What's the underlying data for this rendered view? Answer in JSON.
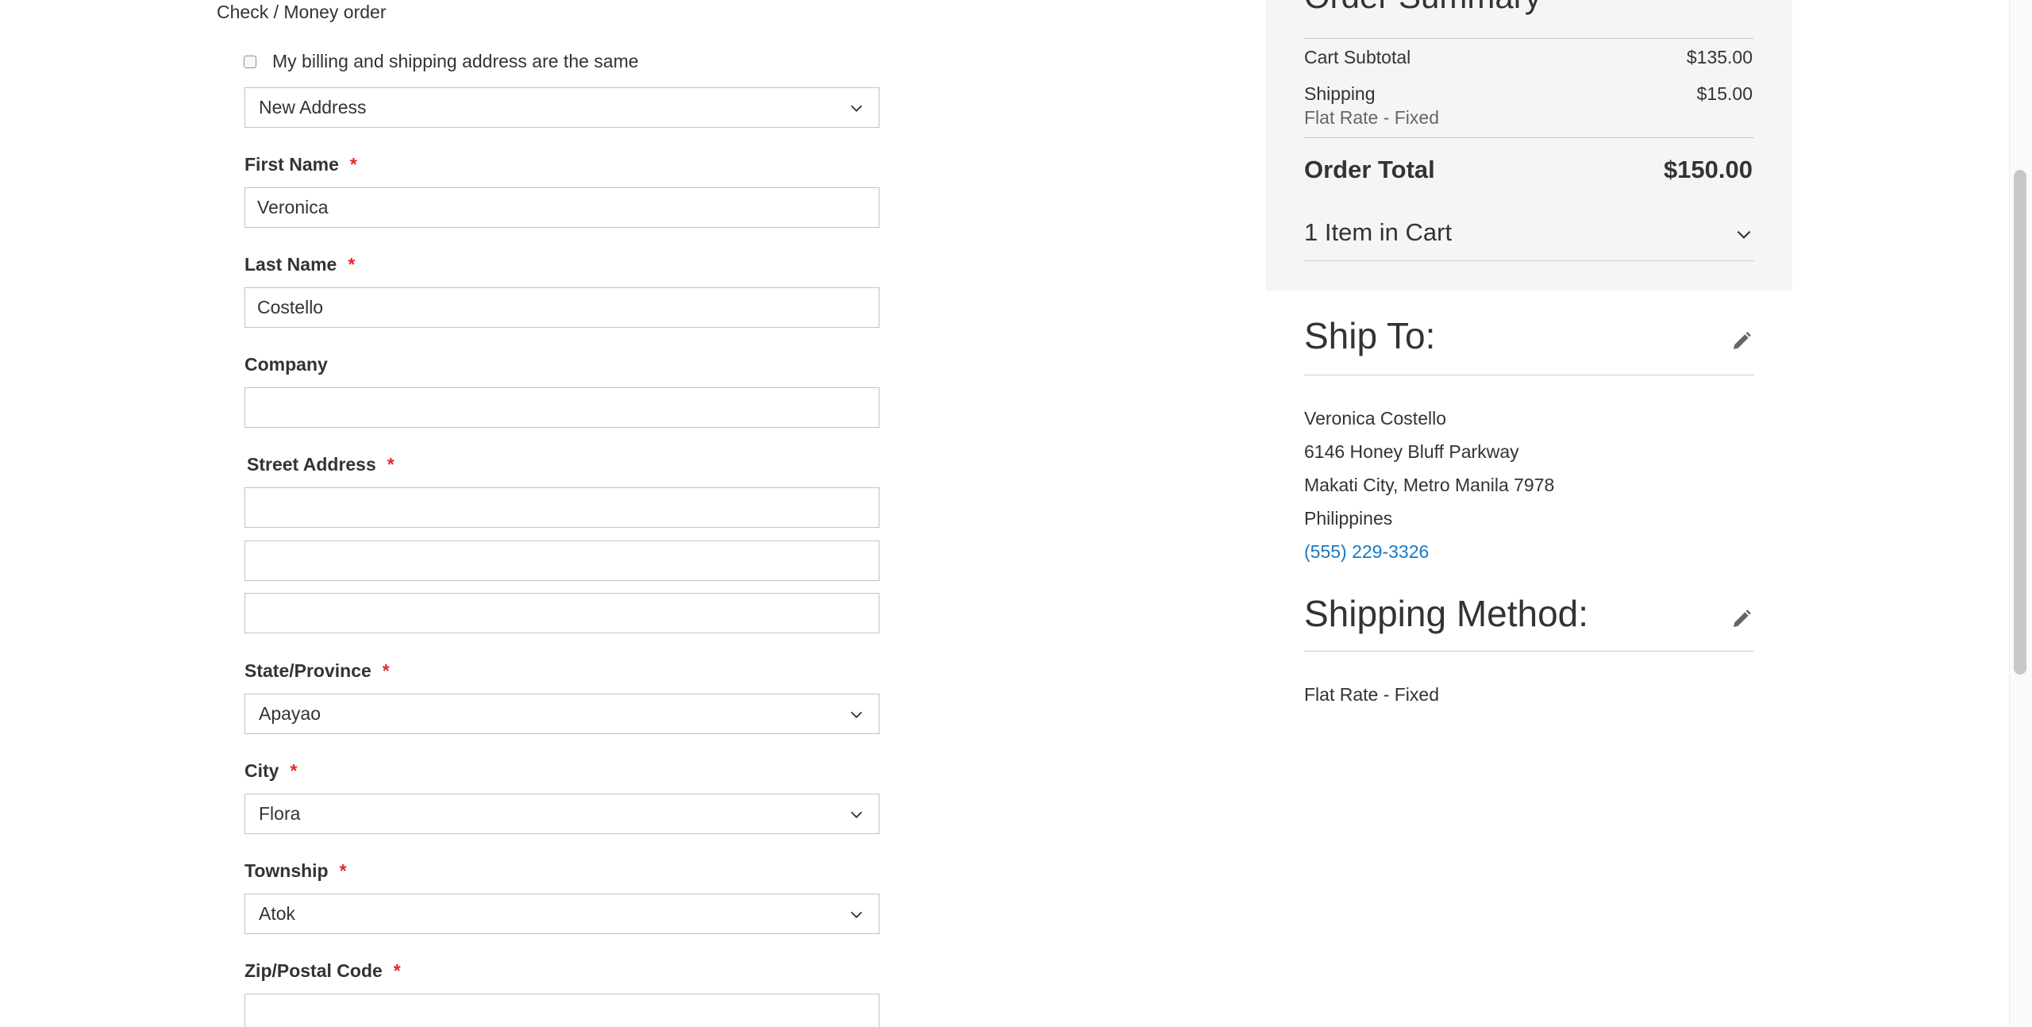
{
  "payment": {
    "method_label": "Check / Money order",
    "same_address_label": "My billing and shipping address are the same",
    "same_address_checked": false
  },
  "billing_form": {
    "address_select": {
      "value": "New Address"
    },
    "first_name": {
      "label": "First Name",
      "value": "Veronica",
      "required": true
    },
    "last_name": {
      "label": "Last Name",
      "value": "Costello",
      "required": true
    },
    "company": {
      "label": "Company",
      "value": ""
    },
    "street": {
      "label": "Street Address",
      "required": true,
      "lines": [
        "",
        "",
        ""
      ]
    },
    "state": {
      "label": "State/Province",
      "value": "Apayao",
      "required": true
    },
    "city": {
      "label": "City",
      "value": "Flora",
      "required": true
    },
    "township": {
      "label": "Township",
      "value": "Atok",
      "required": true
    },
    "zip": {
      "label": "Zip/Postal Code",
      "value": "",
      "required": true
    },
    "required_marker": "*"
  },
  "order_summary": {
    "title": "Order Summary",
    "cart_subtotal_label": "Cart Subtotal",
    "cart_subtotal_value": "$135.00",
    "shipping_label": "Shipping",
    "shipping_value": "$15.00",
    "shipping_method_name": "Flat Rate - Fixed",
    "order_total_label": "Order Total",
    "order_total_value": "$150.00",
    "items_in_cart": "1 Item in Cart"
  },
  "ship_to": {
    "title": "Ship To:",
    "name": "Veronica Costello",
    "street": "6146 Honey Bluff Parkway",
    "city_line": "Makati City, Metro Manila 7978",
    "country": "Philippines",
    "phone": "(555) 229-3326"
  },
  "shipping_method": {
    "title": "Shipping Method:",
    "value": "Flat Rate - Fixed"
  },
  "colors": {
    "required": "#e02b27",
    "link": "#1979c3",
    "summary_bg": "#f5f5f5",
    "border": "#c2c2c2"
  },
  "icons": {
    "dropdown": "chevron-down-icon",
    "edit": "pencil-icon",
    "checkbox": "checkbox-icon"
  }
}
